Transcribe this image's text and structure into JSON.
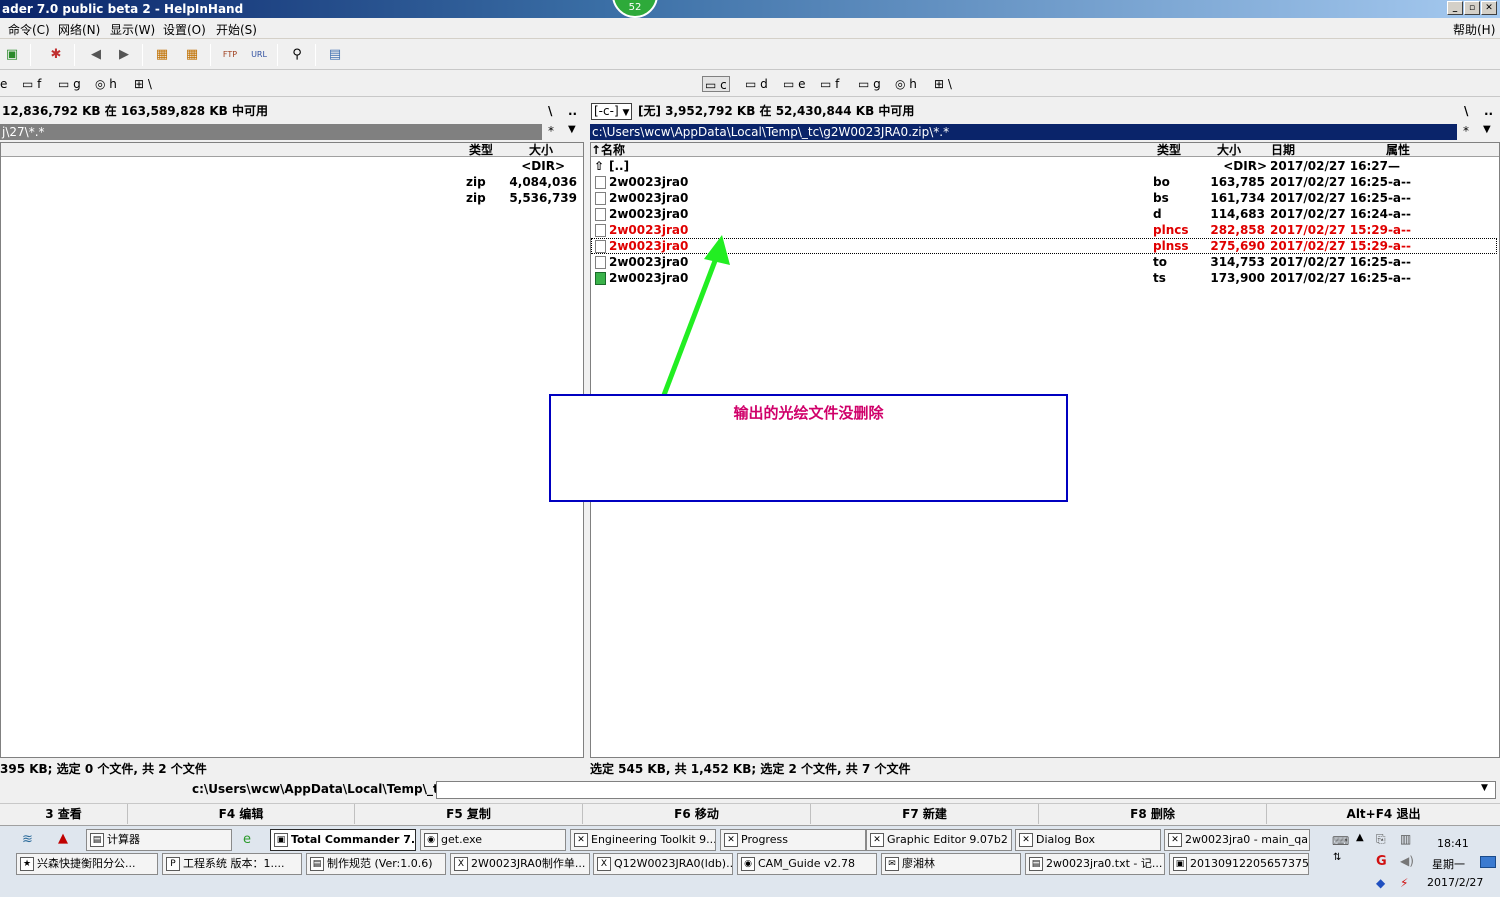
{
  "window": {
    "title": "ader 7.0 public beta 2 - HelpInHand",
    "badge": "52"
  },
  "menu": {
    "items": [
      "命令(C)",
      "网络(N)",
      "显示(W)",
      "设置(O)",
      "开始(S)"
    ],
    "help": "帮助(H)"
  },
  "drives_left": [
    "e",
    "f",
    "g",
    "h",
    "\\"
  ],
  "drives_right": [
    "c",
    "d",
    "e",
    "f",
    "g",
    "h",
    "\\"
  ],
  "left": {
    "info": "12,836,792 KB 在 163,589,828 KB 中可用",
    "path": "j\\27\\*.*",
    "cols": {
      "type": "类型",
      "size": "大小"
    },
    "rows": [
      {
        "type": "",
        "size": "<DIR>"
      },
      {
        "type": "zip",
        "size": "4,084,036"
      },
      {
        "type": "zip",
        "size": "5,536,739"
      }
    ],
    "status": "395 KB; 选定 0 个文件, 共 2 个文件"
  },
  "right": {
    "drive_select": "[-c-]",
    "info": "[无] 3,952,792 KB 在 52,430,844 KB 中可用",
    "path": "c:\\Users\\wcw\\AppData\\Local\\Temp\\_tc\\g2W0023JRA0.zip\\*.*",
    "cols": {
      "name": "↑名称",
      "type": "类型",
      "size": "大小",
      "date": "日期",
      "attr": "属性"
    },
    "rows": [
      {
        "name": "[..]",
        "type": "",
        "size": "<DIR>",
        "date": "2017/02/27 16:27—",
        "selected": false
      },
      {
        "name": "2w0023jra0",
        "type": "bo",
        "size": "163,785",
        "date": "2017/02/27 16:25-a--",
        "selected": false
      },
      {
        "name": "2w0023jra0",
        "type": "bs",
        "size": "161,734",
        "date": "2017/02/27 16:25-a--",
        "selected": false
      },
      {
        "name": "2w0023jra0",
        "type": "d",
        "size": "114,683",
        "date": "2017/02/27 16:24-a--",
        "selected": false
      },
      {
        "name": "2w0023jra0",
        "type": "plncs",
        "size": "282,858",
        "date": "2017/02/27 15:29-a--",
        "selected": true
      },
      {
        "name": "2w0023jra0",
        "type": "plnss",
        "size": "275,690",
        "date": "2017/02/27 15:29-a--",
        "selected": true
      },
      {
        "name": "2w0023jra0",
        "type": "to",
        "size": "314,753",
        "date": "2017/02/27 16:25-a--",
        "selected": false
      },
      {
        "name": "2w0023jra0",
        "type": "ts",
        "size": "173,900",
        "date": "2017/02/27 16:25-a--",
        "selected": false
      }
    ],
    "status": "选定 545 KB, 共 1,452 KB; 选定 2 个文件, 共 7 个文件"
  },
  "annotation": {
    "text": "输出的光绘文件没删除",
    "arrow_color": "#22ee22",
    "box_color": "#0000c0"
  },
  "cmdline": {
    "prompt": "c:\\Users\\wcw\\AppData\\Local\\Temp\\_tc>",
    "value": ""
  },
  "fkeys": [
    "3 查看",
    "F4 编辑",
    "F5 复制",
    "F6 移动",
    "F7 新建",
    "F8 删除",
    "Alt+F4 退出"
  ],
  "taskbar": {
    "row1": [
      "计算器",
      "Total Commander 7...",
      "get.exe",
      "Engineering Toolkit 9....",
      "Progress",
      "Graphic Editor 9.07b2 ...",
      "Dialog Box",
      "2w0023jra0 - main_qa"
    ],
    "row2": [
      "兴森快捷衡阳分公...",
      "工程系统  版本：1....",
      "制作规范 (Ver:1.0.6)",
      "2W0023JRA0制作单...",
      "Q12W0023JRA0(ldb)...",
      "CAM_Guide v2.78",
      "廖湘林",
      "2w0023jra0.txt - 记...",
      "20130912205657375..."
    ],
    "clock": {
      "time": "18:41",
      "weekday": "星期一",
      "date": "2017/2/27"
    }
  }
}
